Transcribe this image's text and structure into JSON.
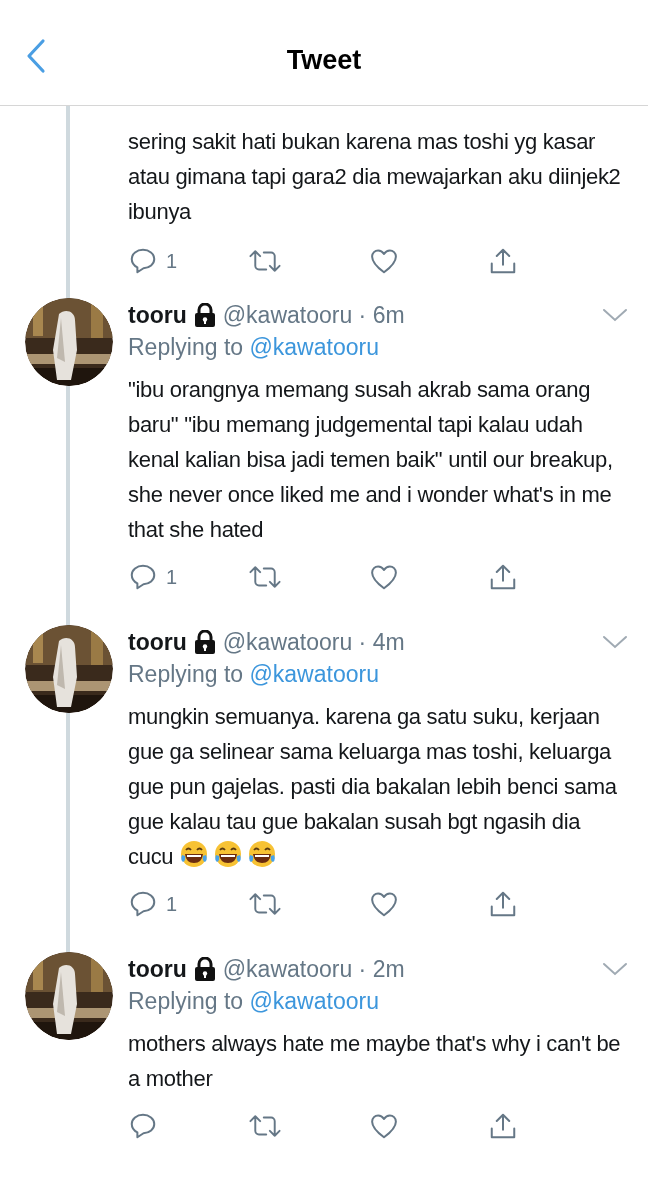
{
  "navbar": {
    "title": "Tweet"
  },
  "thread_top": {
    "text": "sering sakit hati bukan karena mas toshi yg kasar atau gimana tapi gara2 dia mewajarkan aku diinjek2 ibunya",
    "replies": "1"
  },
  "tweets": [
    {
      "name": "tooru",
      "protected": true,
      "handle": "@kawatooru",
      "separator": "·",
      "time": "6m",
      "replying_label": "Replying to",
      "replying_to": "@kawatooru",
      "text": "\"ibu orangnya memang susah akrab sama orang baru\" \"ibu memang judgemental tapi kalau udah kenal kalian bisa jadi temen baik\" until our breakup, she never once liked me and i wonder what's in me that she hated",
      "replies": "1",
      "thread_below": true
    },
    {
      "name": "tooru",
      "protected": true,
      "handle": "@kawatooru",
      "separator": "·",
      "time": "4m",
      "replying_label": "Replying to",
      "replying_to": "@kawatooru",
      "text": "mungkin semuanya. karena ga satu suku, kerjaan gue ga selinear sama keluarga mas toshi, keluarga gue pun gajelas. pasti dia bakalan lebih benci sama gue kalau tau gue bakalan susah bgt ngasih dia cucu",
      "emojis": [
        {
          "kind": "tears-of-joy"
        },
        {
          "kind": "tears-of-joy"
        },
        {
          "kind": "tears-of-joy"
        }
      ],
      "replies": "1",
      "thread_below": true
    },
    {
      "name": "tooru",
      "protected": true,
      "handle": "@kawatooru",
      "separator": "·",
      "time": "2m",
      "replying_label": "Replying to",
      "replying_to": "@kawatooru",
      "text": "mothers always hate me maybe that's why i can't be a mother",
      "thread_below": false
    }
  ]
}
